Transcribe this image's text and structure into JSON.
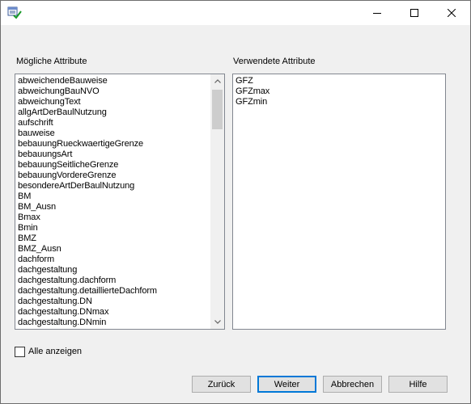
{
  "window": {
    "icons": {
      "app": "table-check-icon",
      "minimize": "minimize-icon",
      "maximize": "maximize-icon",
      "close": "close-icon"
    }
  },
  "possible": {
    "label": "Mögliche Attribute",
    "items": [
      "abweichendeBauweise",
      "abweichungBauNVO",
      "abweichungText",
      "allgArtDerBaulNutzung",
      "aufschrift",
      "bauweise",
      "bebauungRueckwaertigeGrenze",
      "bebauungsArt",
      "bebauungSeitlicheGrenze",
      "bebauungVordereGrenze",
      "besondereArtDerBaulNutzung",
      "BM",
      "BM_Ausn",
      "Bmax",
      "Bmin",
      "BMZ",
      "BMZ_Ausn",
      "dachform",
      "dachgestaltung",
      "dachgestaltung.dachform",
      "dachgestaltung.detaillierteDachform",
      "dachgestaltung.DN",
      "dachgestaltung.DNmax",
      "dachgestaltung.DNmin"
    ],
    "scroll_fraction": 0.0
  },
  "used": {
    "label": "Verwendete Attribute",
    "items": [
      "GFZ",
      "GFZmax",
      "GFZmin"
    ]
  },
  "show_all": {
    "label": "Alle anzeigen",
    "checked": false
  },
  "buttons": {
    "back": "Zurück",
    "next": "Weiter",
    "cancel": "Abbrechen",
    "help": "Hilfe"
  }
}
